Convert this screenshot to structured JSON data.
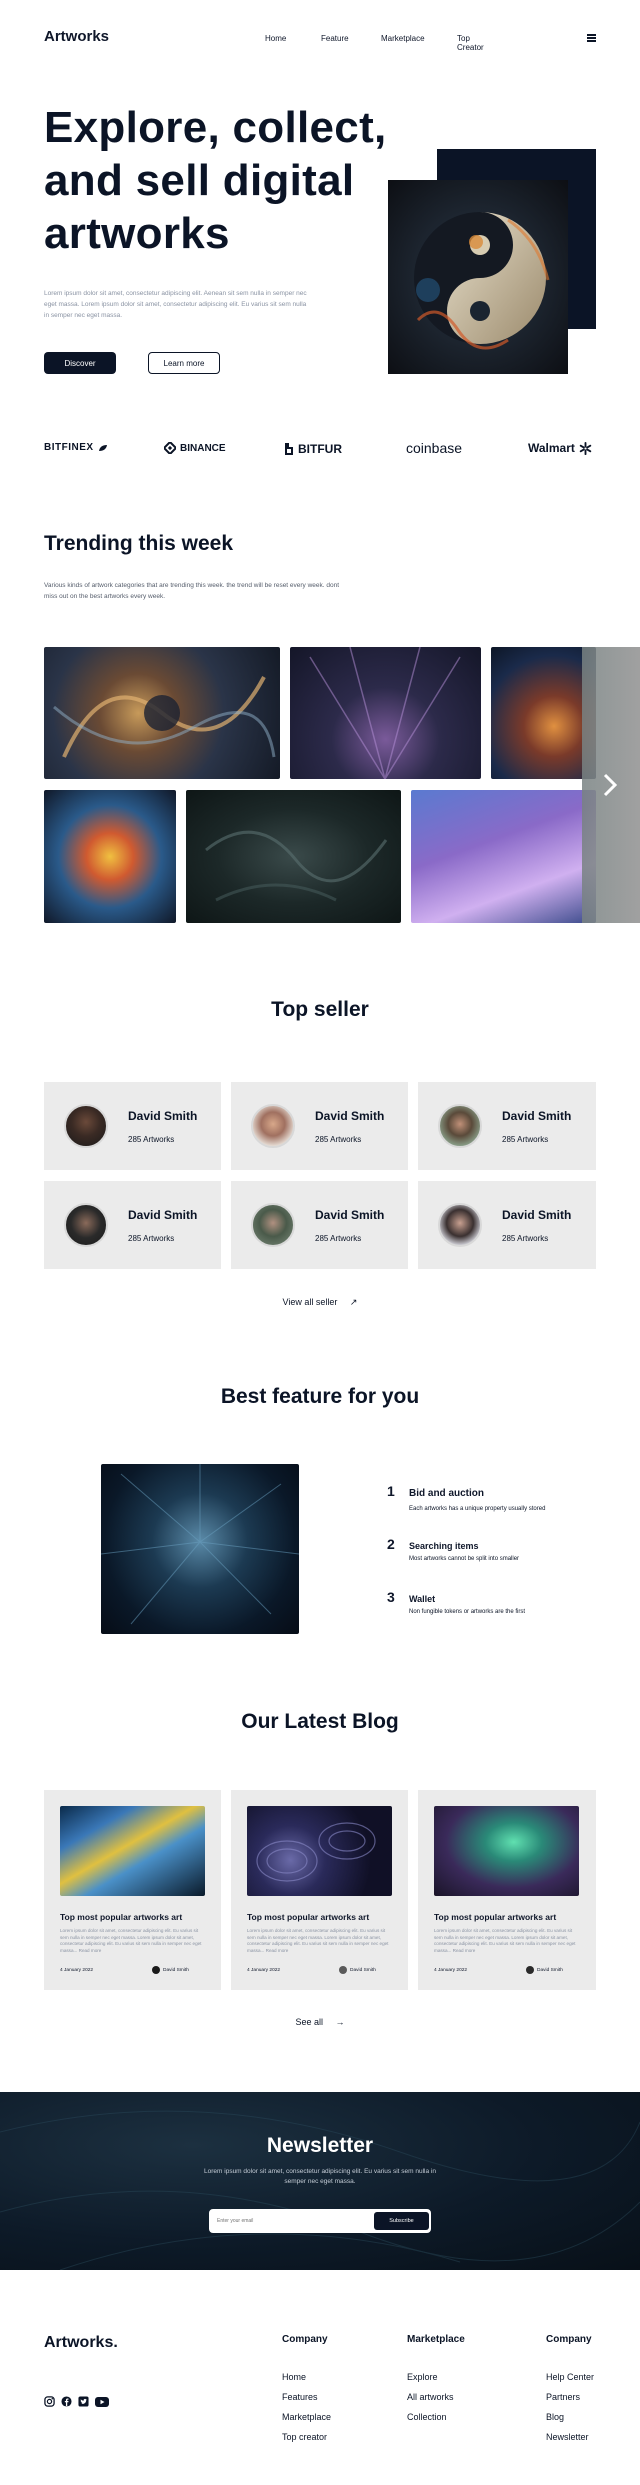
{
  "header": {
    "logo": "Artworks",
    "nav": [
      "Home",
      "Feature",
      "Marketplace",
      "Top Creator"
    ],
    "menu_icon": "hamburger-icon"
  },
  "hero": {
    "title_lines": [
      "Explore, collect,",
      "and sell digital",
      "artworks"
    ],
    "description_lines": [
      "Lorem ipsum dolor sit amet, consectetur adipiscing elit. Aenean sit sem nulla in semper nec",
      "eget massa. Lorem ipsum dolor sit amet, consectetur adipiscing elit. Eu varius sit sem nulla",
      "in semper nec eget massa."
    ],
    "primary_button": "Discover",
    "secondary_button": "Learn more"
  },
  "brands": [
    "BITFINEX",
    "BINANCE",
    "BITFUR",
    "coinbase",
    "Walmart"
  ],
  "trending": {
    "title": "Trending this week",
    "description_lines": [
      "Various kinds of artwork categories that are trending this week. the trend will be reset every week. dont",
      "miss out on the best artworks every week."
    ],
    "next_icon": "chevron-right-icon"
  },
  "top_seller": {
    "title": "Top seller",
    "sellers": [
      {
        "name": "David Smith",
        "artworks": "285 Artworks"
      },
      {
        "name": "David Smith",
        "artworks": "285 Artworks"
      },
      {
        "name": "David Smith",
        "artworks": "285 Artworks"
      },
      {
        "name": "David Smith",
        "artworks": "285 Artworks"
      },
      {
        "name": "David Smith",
        "artworks": "285 Artworks"
      },
      {
        "name": "David Smith",
        "artworks": "285 Artworks"
      }
    ],
    "view_all": "View all seller"
  },
  "features": {
    "title": "Best feature for you",
    "items": [
      {
        "number": "1",
        "title": "Bid and auction",
        "desc": "Each artworks has a unique property usually stored"
      },
      {
        "number": "2",
        "title": "Searching items",
        "desc": "Most artworks cannot be split into smaller"
      },
      {
        "number": "3",
        "title": "Wallet",
        "desc": "Non fungible tokens or artworks are the first"
      }
    ]
  },
  "blog": {
    "title": "Our Latest Blog",
    "posts": [
      {
        "title": "Top most popular artworks art",
        "excerpt": "Lorem ipsum dolor sit amet, consectetur adipiscing elit. Eu varius sit sem nulla in semper nec eget massa. Lorem ipsum dolor sit amet, consectetur adipiscing elit. Eu varius sit sem nulla in semper nec eget massa... Read more",
        "date": "4 January 2022",
        "author": "David Smith"
      },
      {
        "title": "Top most popular artworks art",
        "excerpt": "Lorem ipsum dolor sit amet, consectetur adipiscing elit. Eu varius sit sem nulla in semper nec eget massa. Lorem ipsum dolor sit amet, consectetur adipiscing elit. Eu varius sit sem nulla in semper nec eget massa... Read more",
        "date": "4 January 2022",
        "author": "David Smith"
      },
      {
        "title": "Top most popular artworks art",
        "excerpt": "Lorem ipsum dolor sit amet, consectetur adipiscing elit. Eu varius sit sem nulla in semper nec eget massa. Lorem ipsum dolor sit amet, consectetur adipiscing elit. Eu varius sit sem nulla in semper nec eget massa... Read more",
        "date": "4 January 2022",
        "author": "David Smith"
      }
    ],
    "see_all": "See all"
  },
  "newsletter": {
    "title": "Newsletter",
    "description_lines": [
      "Lorem ipsum dolor sit amet, consectetur adipiscing elit. Eu varius sit sem nulla in",
      "semper nec eget massa."
    ],
    "email_placeholder": "Enter your email",
    "button": "Subscribe"
  },
  "footer": {
    "logo": "Artworks.",
    "social_icons": [
      "instagram-icon",
      "facebook-icon",
      "twitter-icon",
      "youtube-icon"
    ],
    "columns": [
      {
        "title": "Company",
        "links": [
          "Home",
          "Features",
          "Marketplace",
          "Top creator"
        ]
      },
      {
        "title": "Marketplace",
        "links": [
          "Explore",
          "All artworks",
          "Collection"
        ]
      },
      {
        "title": "Company",
        "links": [
          "Help Center",
          "Partners",
          "Blog",
          "Newsletter"
        ]
      }
    ]
  },
  "colors": {
    "primary": "#0b1426",
    "muted": "#8a93a3",
    "card": "#ebebeb",
    "newsletter_bg": "#0d1a28"
  }
}
